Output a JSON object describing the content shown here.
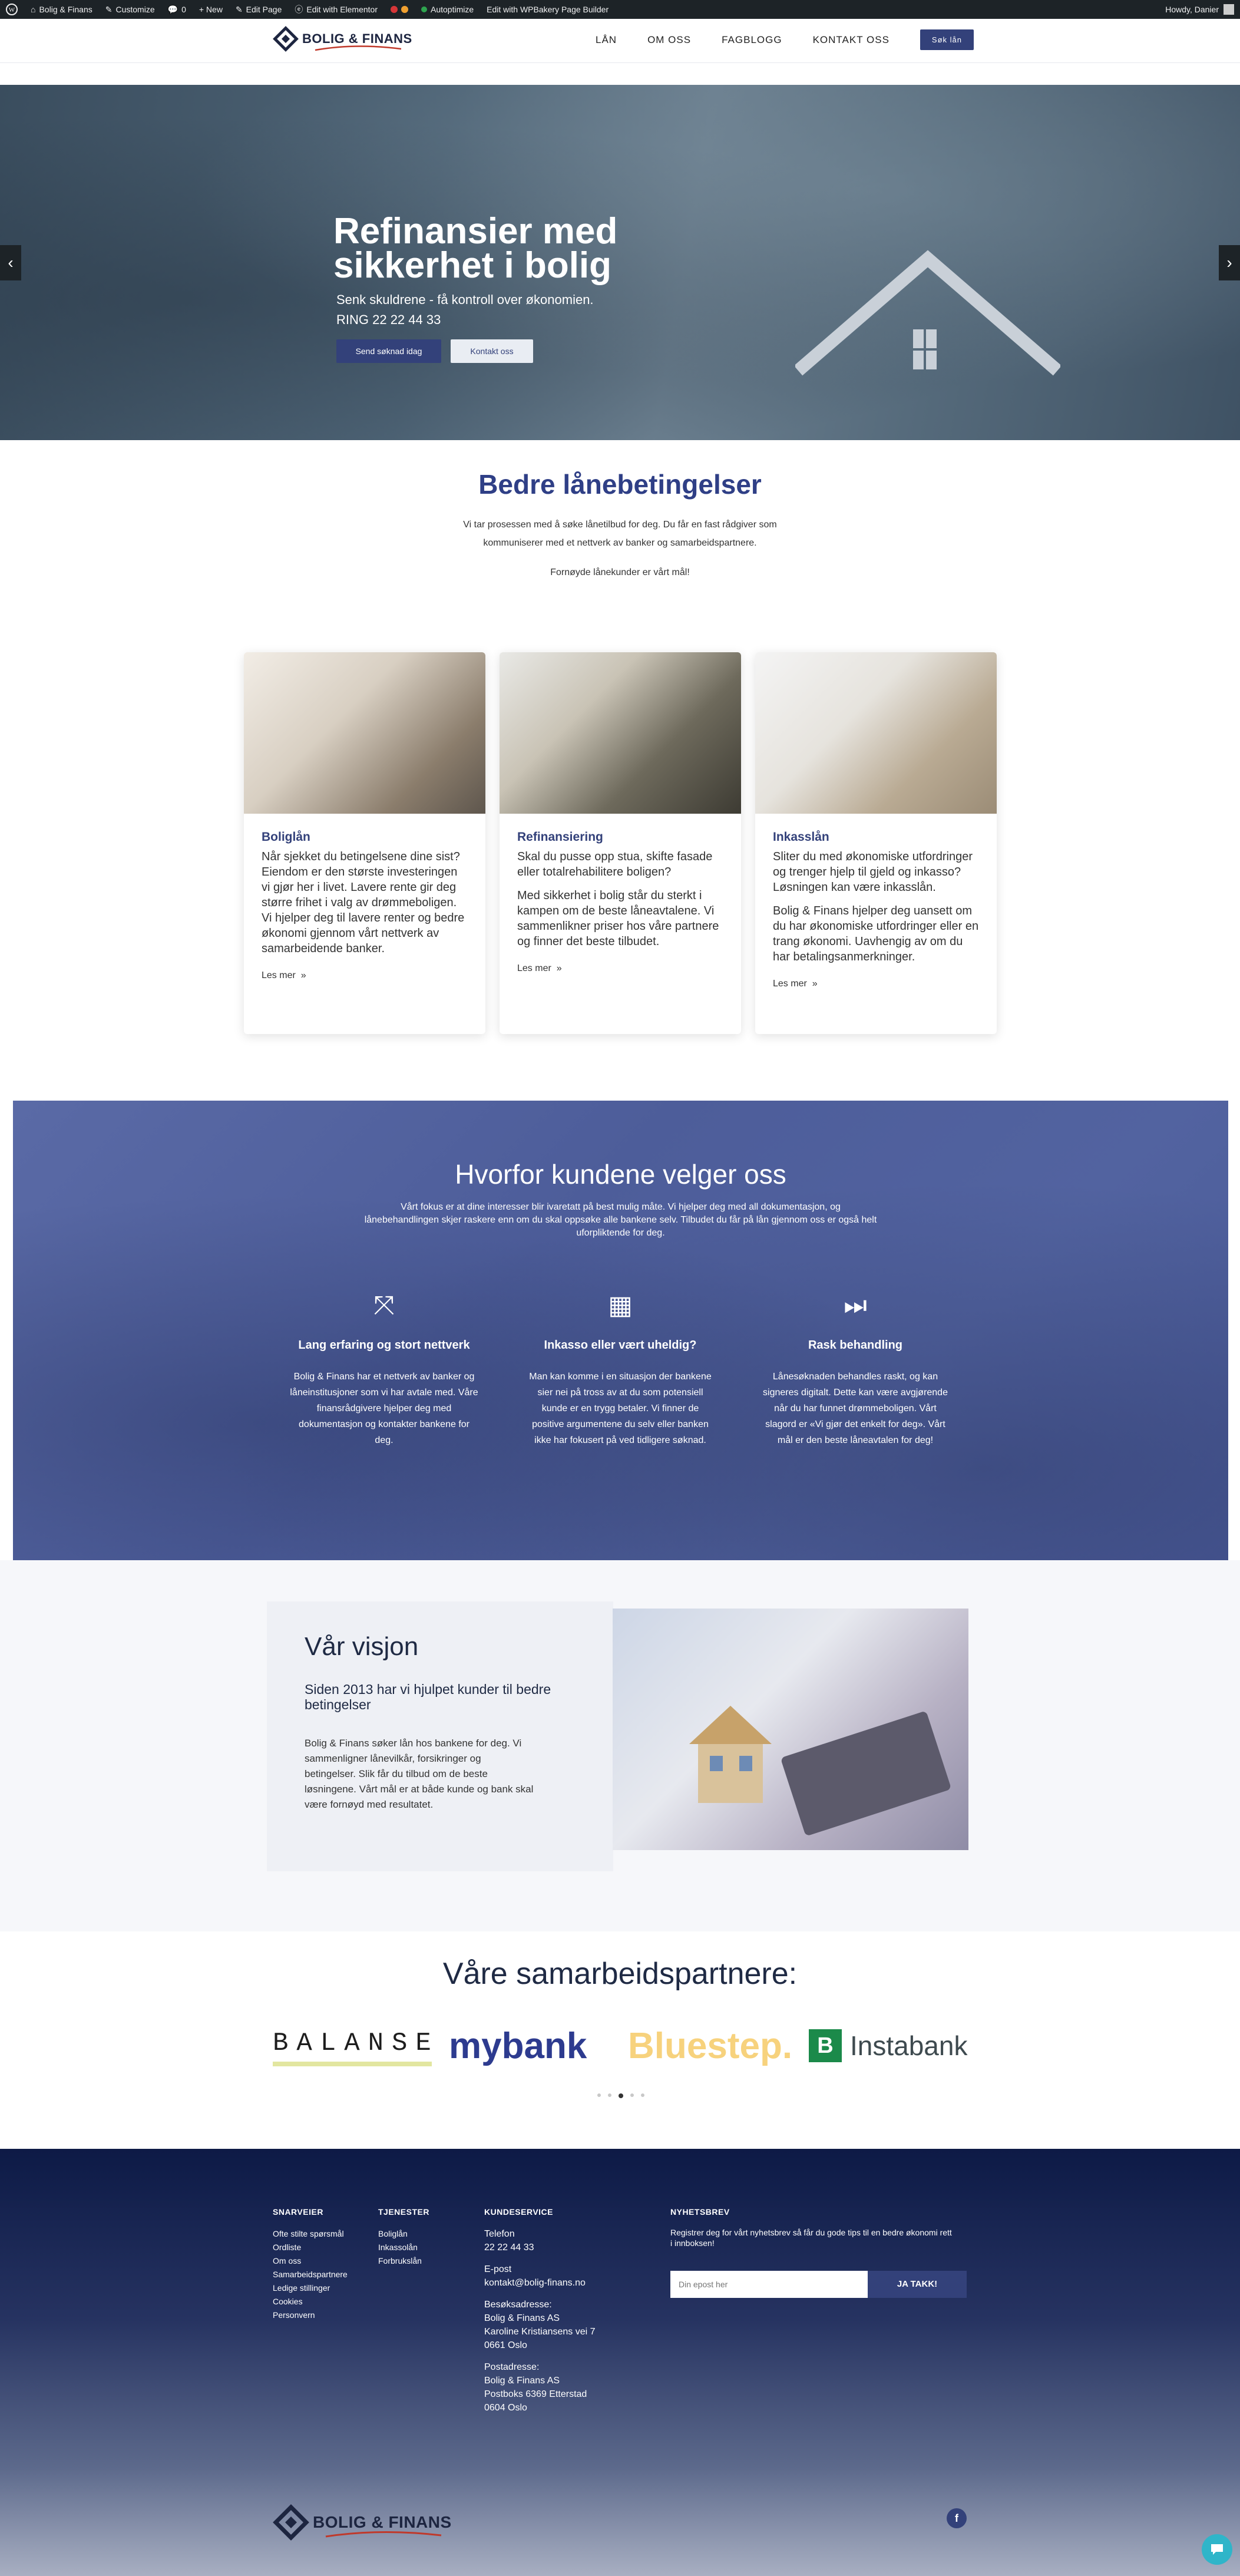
{
  "admin_bar": {
    "wp_icon": "wordpress-icon",
    "site_name": "Bolig & Finans",
    "customize": "Customize",
    "comments_count": "0",
    "new": "+ New",
    "edit_page": "Edit Page",
    "edit_elementor": "Edit with Elementor",
    "autoptimize": "Autoptimize",
    "wpbakery": "Edit with WPBakery Page Builder",
    "howdy": "Howdy, Danier"
  },
  "header": {
    "logo_text": "BOLIG & FINANS",
    "nav": [
      "LÅN",
      "OM OSS",
      "FAGBLOGG",
      "KONTAKT OSS"
    ],
    "cta": "Søk lån"
  },
  "hero": {
    "title_line1": "Refinansier med",
    "title_line2": "sikkerhet i bolig",
    "subtitle": "Senk skuldrene - få kontroll over økonomien.",
    "phone": "RING 22 22 44 33",
    "primary_button": "Send søknad idag",
    "secondary_button": "Kontakt oss",
    "prev": "‹",
    "next": "›"
  },
  "intro": {
    "title": "Bedre lånebetingelser",
    "text_line1": "Vi tar prosessen med å søke lånetilbud for deg. Du får en fast rådgiver som",
    "text_line2": "kommuniserer med et nettverk av banker og samarbeidspartnere.",
    "tagline": "Fornøyde lånekunder er vårt mål!"
  },
  "cards": [
    {
      "title": "Boliglån",
      "p1": "Når sjekket du betingelsene dine sist? Eiendom er den største investeringen vi gjør her i livet. Lavere rente gir deg større frihet i valg av drømmeboligen. Vi hjelper deg til lavere renter og bedre økonomi gjennom vårt nettverk av samarbeidende banker.",
      "p2": "",
      "more": "Les mer"
    },
    {
      "title": "Refinansiering",
      "p1": "Skal du pusse opp stua, skifte fasade eller totalrehabilitere boligen?",
      "p2": "Med sikkerhet i bolig står du sterkt i kampen om de beste låneavtalene.  Vi sammenlikner priser hos våre partnere og finner det beste tilbudet.",
      "more": "Les mer"
    },
    {
      "title": "Inkasslån",
      "p1": "Sliter du med økonomiske utfordringer og trenger hjelp til gjeld og inkasso? Løsningen kan være inkasslån.",
      "p2": "Bolig & Finans hjelper deg uansett om du har økonomiske utfordringer eller en trang økonomi. Uavhengig av om du har betalingsanmerkninger.",
      "more": "Les mer"
    }
  ],
  "why": {
    "title": "Hvorfor kundene velger oss",
    "intro_line1": "Vårt fokus er at dine interesser blir ivaretatt på best mulig måte. Vi hjelper deg med all dokumentasjon, og",
    "intro_line2": "lånebehandlingen skjer raskere enn om du skal oppsøke alle bankene selv. Tilbudet du får på lån gjennom oss er også helt",
    "intro_line3": "uforpliktende for deg.",
    "columns": [
      {
        "icon": "expand-icon",
        "glyph": "⤧",
        "title": "Lang erfaring og stort nettverk",
        "text": "Bolig & Finans har et nettverk av banker og låneinstitusjoner som vi har avtale med. Våre finansrådgivere hjelper deg med dokumentasjon og kontakter bankene for deg."
      },
      {
        "icon": "calculator-icon",
        "glyph": "▦",
        "title": "Inkasso eller vært uheldig?",
        "text": "Man kan komme i en situasjon der bankene sier nei på tross av at du som potensiell kunde er en trygg betaler. Vi finner de positive argumentene du selv eller banken ikke har fokusert på ved tidligere søknad."
      },
      {
        "icon": "fast-forward-icon",
        "glyph": "⏭",
        "title": "Rask behandling",
        "text": "Lånesøknaden behandles raskt, og kan signeres digitalt. Dette kan være avgjørende når du har funnet drømmeboligen. Vårt slagord er «Vi gjør det enkelt for deg». Vårt mål er den beste låneavtalen for deg!"
      }
    ]
  },
  "vision": {
    "title": "Vår visjon",
    "subtitle": "Siden 2013 har vi hjulpet kunder til bedre betingelser",
    "text": "Bolig & Finans søker lån hos bankene for deg. Vi sammenligner lånevilkår, forsikringer og betingelser. Slik får du tilbud om de beste løsningene. Vårt mål er at både kunde og bank skal være fornøyd med resultatet."
  },
  "partners": {
    "title": "Våre samarbeidspartnere:",
    "logos": [
      "BALANSE",
      "mybank",
      "Bluestep.",
      "Instabank"
    ],
    "dots_active": 3
  },
  "footer": {
    "col1_title": "SNARVEIER",
    "col1_links": [
      "Ofte stilte spørsmål",
      "Ordliste",
      "Om oss",
      "Samarbeidspartnere",
      "Ledige stillinger",
      "Cookies",
      "Personvern"
    ],
    "col2_title": "TJENESTER",
    "col2_links": [
      "Boliglån",
      "Inkassolån",
      "Forbrukslån"
    ],
    "col3_title": "KUNDESERVICE",
    "phone_label": "Telefon",
    "phone": "22 22 44 33",
    "email_label": "E-post",
    "email": "kontakt@bolig-finans.no",
    "visit_label": "Besøksadresse:",
    "visit_lines": [
      "Bolig & Finans AS",
      "Karoline Kristiansens vei 7",
      "0661 Oslo"
    ],
    "post_label": "Postadresse:",
    "post_lines": [
      "Bolig & Finans AS",
      "Postboks 6369 Etterstad",
      "0604 Oslo"
    ],
    "col4_title": "NYHETSBREV",
    "newsletter_text": "Registrer deg for vårt nyhetsbrev så får du gode tips til en bedre økonomi rett i innboksen!",
    "email_placeholder": "Din epost her",
    "subscribe": "JA TAKK!",
    "logo_text": "BOLIG & FINANS",
    "facebook": "f"
  },
  "colors": {
    "brand_navy": "#33417a",
    "title_blue": "#2f3f86",
    "admin_bar": "#1d2327"
  }
}
